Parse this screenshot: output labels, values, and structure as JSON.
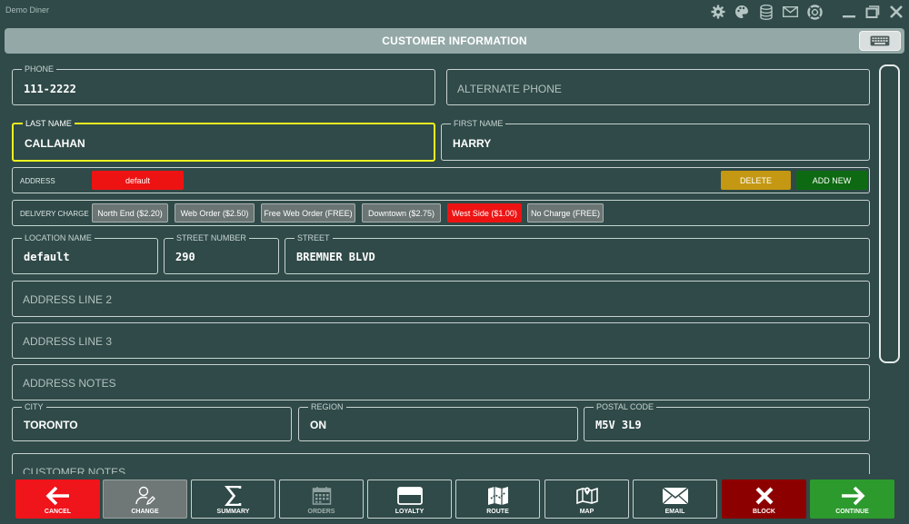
{
  "app": {
    "title": "Demo Diner"
  },
  "header": {
    "title": "CUSTOMER INFORMATION"
  },
  "fields": {
    "phone": {
      "label": "PHONE",
      "value": "111-2222"
    },
    "alternate_phone": {
      "placeholder": "ALTERNATE PHONE"
    },
    "last_name": {
      "label": "LAST NAME",
      "value": "CALLAHAN"
    },
    "first_name": {
      "label": "FIRST NAME",
      "value": "HARRY"
    },
    "location_name": {
      "label": "LOCATION NAME",
      "value": "default"
    },
    "street_number": {
      "label": "STREET NUMBER",
      "value": "290"
    },
    "street": {
      "label": "STREET",
      "value": "BREMNER BLVD"
    },
    "address_line_2": {
      "placeholder": "ADDRESS LINE 2"
    },
    "address_line_3": {
      "placeholder": "ADDRESS LINE 3"
    },
    "address_notes": {
      "placeholder": "ADDRESS NOTES"
    },
    "city": {
      "label": "CITY",
      "value": "TORONTO"
    },
    "region": {
      "label": "REGION",
      "value": "ON"
    },
    "postal_code": {
      "label": "POSTAL CODE",
      "value": "M5V 3L9"
    },
    "customer_notes": {
      "placeholder": "CUSTOMER NOTES"
    }
  },
  "address": {
    "label": "ADDRESS",
    "selected": "default",
    "delete_label": "DELETE",
    "add_new_label": "ADD NEW"
  },
  "delivery_charge": {
    "label": "DELIVERY CHARGE",
    "options": [
      "North End ($2.20)",
      "Web Order ($2.50)",
      "Free Web Order (FREE)",
      "Downtown ($2.75)",
      "West Side ($1.00)",
      "No Charge (FREE)"
    ],
    "selected": "West Side ($1.00)"
  },
  "toolbar": {
    "buttons": [
      {
        "label": "CANCEL",
        "icon": "arrow-left-icon"
      },
      {
        "label": "CHANGE",
        "icon": "user-edit-icon"
      },
      {
        "label": "SUMMARY",
        "icon": "sigma-icon"
      },
      {
        "label": "ORDERS",
        "icon": "calendar-icon"
      },
      {
        "label": "LOYALTY",
        "icon": "card-icon"
      },
      {
        "label": "ROUTE",
        "icon": "route-map-icon"
      },
      {
        "label": "MAP",
        "icon": "map-icon"
      },
      {
        "label": "EMAIL",
        "icon": "envelope-icon"
      },
      {
        "label": "BLOCK",
        "icon": "x-icon"
      },
      {
        "label": "CONTINUE",
        "icon": "arrow-right-icon"
      }
    ]
  },
  "colors": {
    "background": "#2f4a48",
    "header": "#94a9a7",
    "selected_red": "#ee1313",
    "delete_gold": "#c49812",
    "add_new_green": "#0e6a12",
    "focus_yellow": "#f0f020",
    "continue_green": "#2d9a2e",
    "block_darkred": "#8c0000"
  }
}
